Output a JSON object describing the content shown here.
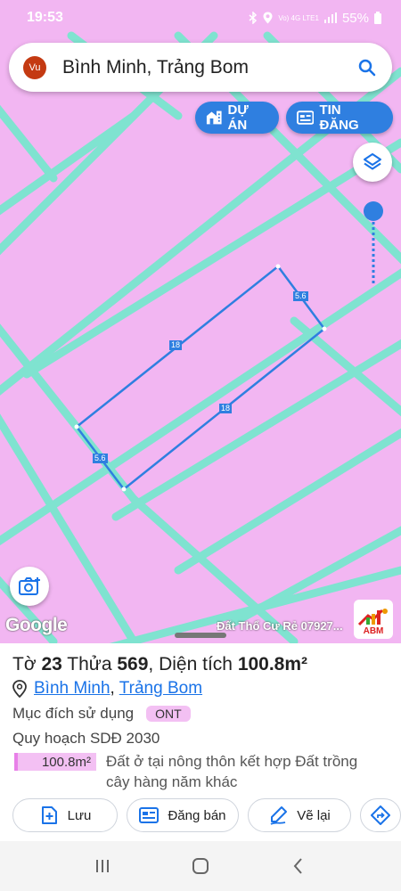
{
  "status_bar": {
    "time": "19:53",
    "network": "Vo) 4G LTE1",
    "battery": "55%"
  },
  "search": {
    "avatar_text": "Vu",
    "query": "Bình Minh, Trảng Bom"
  },
  "map": {
    "du_an_label": "DỰ ÁN",
    "tin_dang_label": "TIN ĐĂNG",
    "google_label": "Google",
    "caption": "Đất Thổ Cư Rẻ 07927...",
    "logo_text": "ABM",
    "edge_labels": [
      "18",
      "18",
      "5.6",
      "5.6"
    ],
    "colors": {
      "land": "#f2b6f2",
      "roads": "#7fe3d0",
      "parcel": "#2f7fe0"
    }
  },
  "parcel": {
    "prefix_to": "Tờ",
    "to_number": "23",
    "prefix_thua": "Thửa",
    "thua_number": "569",
    "prefix_area": ", Diện tích",
    "area": "100.8m²",
    "location": {
      "ward": "Bình Minh",
      "district": "Trảng Bom"
    },
    "purpose_label": "Mục đích sử dụng",
    "purpose_code": "ONT",
    "plan_label": "Quy hoạch SDĐ 2030",
    "plan_area": "100.8m²",
    "plan_description": "Đất ở tại nông thôn kết hợp Đất trồng cây hàng năm khác"
  },
  "actions": {
    "save_label": "Lưu",
    "sell_label": "Đăng bán",
    "draw_label": "Vẽ lại"
  }
}
